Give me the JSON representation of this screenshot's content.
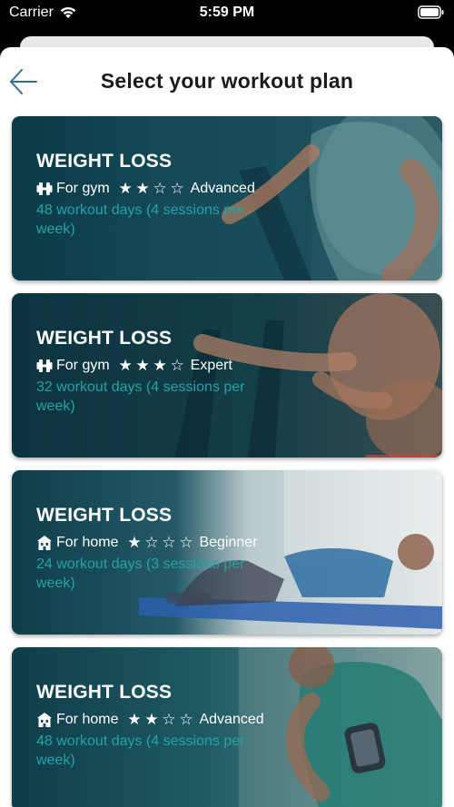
{
  "status_bar": {
    "carrier": "Carrier",
    "time": "5:59 PM"
  },
  "header": {
    "title": "Select your workout plan",
    "back_icon": "arrow-left-icon"
  },
  "colors": {
    "accent_teal": "#22a3a8",
    "back_arrow": "#2f6f8c",
    "card_overlay": "#0f3f4d"
  },
  "plans": [
    {
      "title": "WEIGHT LOSS",
      "location": "For gym",
      "location_icon": "dumbbell-icon",
      "rating": 2,
      "rating_max": 3,
      "level": "Advanced",
      "description": "48 workout days (4 sessions per week)"
    },
    {
      "title": "WEIGHT LOSS",
      "location": "For gym",
      "location_icon": "dumbbell-icon",
      "rating": 3,
      "rating_max": 3,
      "level": "Expert",
      "description": "32 workout days (4 sessions per week)"
    },
    {
      "title": "WEIGHT LOSS",
      "location": "For home",
      "location_icon": "house-icon",
      "rating": 1,
      "rating_max": 3,
      "level": "Beginner",
      "description": "24 workout days (3 sessions per week)"
    },
    {
      "title": "WEIGHT LOSS",
      "location": "For home",
      "location_icon": "house-icon",
      "rating": 2,
      "rating_max": 3,
      "level": "Advanced",
      "description": "48 workout days (4 sessions per week)"
    }
  ]
}
